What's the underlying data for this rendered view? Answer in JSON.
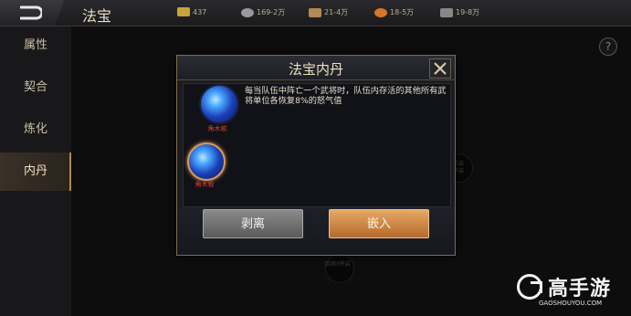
{
  "header": {
    "title": "法宝",
    "resources": [
      {
        "icon": "gold-ingot-icon",
        "value": "437",
        "color": "#c9a23a"
      },
      {
        "icon": "silver-coin-icon",
        "value": "169-2万",
        "color": "#9a9a9a"
      },
      {
        "icon": "scroll-icon",
        "value": "21-4万",
        "color": "#b28a55"
      },
      {
        "icon": "orange-pouch-icon",
        "value": "18-5万",
        "color": "#d8762a"
      },
      {
        "icon": "feather-icon",
        "value": "19-8万",
        "color": "#888888"
      }
    ]
  },
  "sidebar": {
    "items": [
      {
        "label": "属性"
      },
      {
        "label": "契合"
      },
      {
        "label": "炼化"
      },
      {
        "label": "内丹",
        "active": true
      }
    ]
  },
  "background": {
    "node_right_text": "开启\n开启",
    "node_bottom_text": "四项Y开启"
  },
  "dialog": {
    "title": "法宝内丹",
    "description": "每当队伍中阵亡一个武将时，队伍内存活的其他所有武将单位各恢复8%的怒气值",
    "pills": [
      {
        "name": "角木蛟",
        "selected": false
      },
      {
        "name": "角木蛟",
        "selected": true
      }
    ],
    "strip_label": "剥离",
    "embed_label": "嵌入"
  },
  "help": {
    "label": "?"
  },
  "watermark": {
    "text": "高手游",
    "url": "GAOSHOUYOU.COM"
  }
}
